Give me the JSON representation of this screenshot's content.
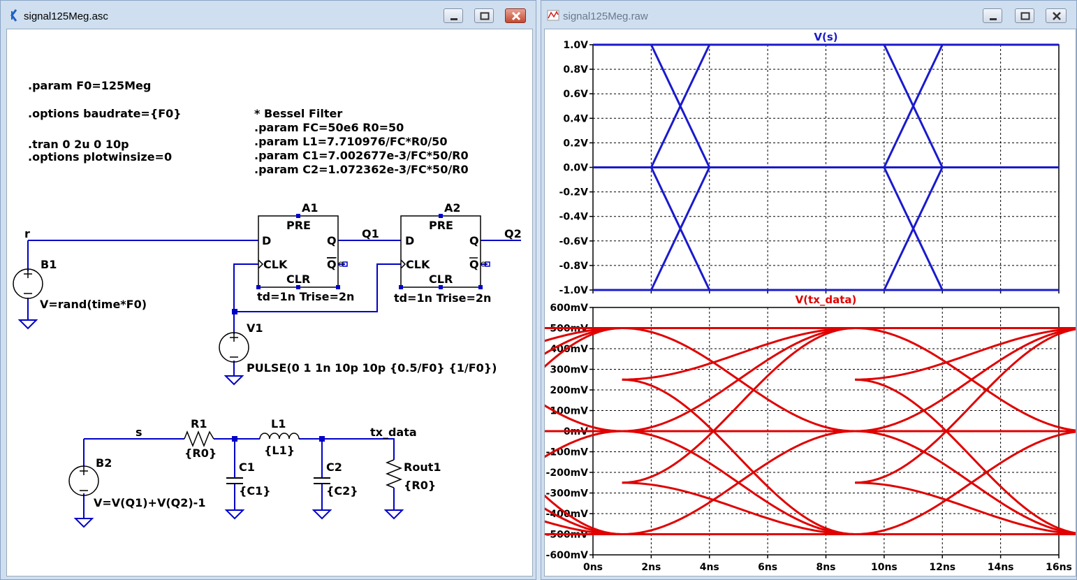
{
  "schematic_window": {
    "title": "signal125Meg.asc",
    "directives": [
      ".param F0=125Meg",
      ".options baudrate={F0}",
      ".tran 0 2u 0 10p",
      ".options plotwinsize=0"
    ],
    "bessel": [
      "* Bessel Filter",
      ".param FC=50e6 R0=50",
      ".param L1=7.710976/FC*R0/50",
      ".param C1=7.002677e-3/FC*50/R0",
      ".param C2=1.072362e-3/FC*50/R0"
    ],
    "components": {
      "a1": {
        "name": "A1",
        "pre": "PRE",
        "clr": "CLR",
        "d": "D",
        "q": "Q",
        "qbar": "Q",
        "clk": "CLK",
        "params": "td=1n Trise=2n"
      },
      "a2": {
        "name": "A2",
        "pre": "PRE",
        "clr": "CLR",
        "d": "D",
        "q": "Q",
        "qbar": "Q",
        "clk": "CLK",
        "params": "td=1n Trise=2n"
      },
      "b1": {
        "name": "B1",
        "value": "V=rand(time*F0)"
      },
      "v1": {
        "name": "V1",
        "value": "PULSE(0 1 1n 10p 10p {0.5/F0} {1/F0})"
      },
      "b2": {
        "name": "B2",
        "value": "V=V(Q1)+V(Q2)-1"
      },
      "r1": {
        "name": "R1",
        "value": "{R0}"
      },
      "l1": {
        "name": "L1",
        "value": "{L1}"
      },
      "c1": {
        "name": "C1",
        "value": "{C1}"
      },
      "c2": {
        "name": "C2",
        "value": "{C2}"
      },
      "rout1": {
        "name": "Rout1",
        "value": "{R0}"
      }
    },
    "nets": {
      "r": "r",
      "q1": "Q1",
      "q2": "Q2",
      "s": "s",
      "tx": "tx_data"
    }
  },
  "waveform_window": {
    "title": "signal125Meg.raw"
  },
  "colors": {
    "wire": "#0000c8",
    "trace_vs": "#1a1acd",
    "trace_tx": "#e00000",
    "grid": "#000000"
  },
  "chart_data": [
    {
      "type": "line",
      "title": "V(s)",
      "x_ticks": [
        "0ns",
        "2ns",
        "4ns",
        "6ns",
        "8ns",
        "10ns",
        "12ns",
        "14ns",
        "16ns"
      ],
      "y_ticks": [
        "1.0V",
        "0.8V",
        "0.6V",
        "0.4V",
        "0.2V",
        "0.0V",
        "-0.2V",
        "-0.4V",
        "-0.6V",
        "-0.8V",
        "-1.0V"
      ],
      "xlim": [
        0,
        16
      ],
      "ylim": [
        -1,
        1
      ],
      "traces": [
        {
          "x": [
            0,
            2,
            4,
            10,
            12,
            16
          ],
          "y": [
            1,
            1,
            1,
            1,
            1,
            1
          ]
        },
        {
          "x": [
            0,
            2,
            4,
            10,
            12,
            16
          ],
          "y": [
            0,
            0,
            0,
            0,
            0,
            0
          ]
        },
        {
          "x": [
            0,
            16
          ],
          "y": [
            -1,
            -1
          ]
        },
        {
          "x": [
            2,
            4
          ],
          "y": [
            1,
            0
          ]
        },
        {
          "x": [
            2,
            4
          ],
          "y": [
            0,
            1
          ]
        },
        {
          "x": [
            2,
            4
          ],
          "y": [
            0,
            -1
          ]
        },
        {
          "x": [
            2,
            4
          ],
          "y": [
            -1,
            0
          ]
        },
        {
          "x": [
            10,
            12
          ],
          "y": [
            1,
            0
          ]
        },
        {
          "x": [
            10,
            12
          ],
          "y": [
            0,
            1
          ]
        },
        {
          "x": [
            10,
            12
          ],
          "y": [
            0,
            -1
          ]
        },
        {
          "x": [
            10,
            12
          ],
          "y": [
            -1,
            0
          ]
        }
      ]
    },
    {
      "type": "line",
      "title": "V(tx_data)",
      "x_ticks": [
        "0ns",
        "2ns",
        "4ns",
        "6ns",
        "8ns",
        "10ns",
        "12ns",
        "14ns",
        "16ns"
      ],
      "y_ticks": [
        "600mV",
        "500mV",
        "400mV",
        "300mV",
        "200mV",
        "100mV",
        "0mV",
        "-100mV",
        "-200mV",
        "-300mV",
        "-400mV",
        "-500mV",
        "-600mV"
      ],
      "xlim": [
        0,
        16
      ],
      "ylim": [
        -600,
        600
      ],
      "curves": [
        {
          "from": 500,
          "to": 500
        },
        {
          "from": -500,
          "to": -500
        },
        {
          "from": 0,
          "to": 0
        },
        {
          "from": 250,
          "to": -500
        },
        {
          "from": 250,
          "to": 500
        },
        {
          "from": -250,
          "to": 500
        },
        {
          "from": -250,
          "to": -500
        },
        {
          "from": 500,
          "to": 0
        },
        {
          "from": -500,
          "to": 0
        },
        {
          "from": 0,
          "to": 500
        },
        {
          "from": 0,
          "to": -500
        }
      ]
    }
  ]
}
